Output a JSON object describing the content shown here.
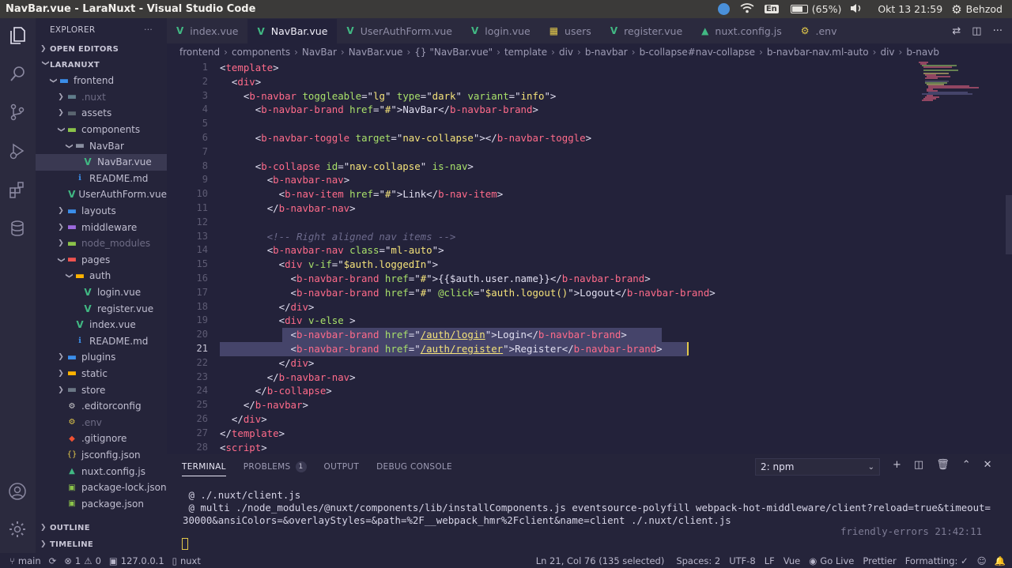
{
  "system": {
    "window_title": "NavBar.vue - LaraNuxt - Visual Studio Code",
    "keyboard": "En",
    "battery": "(65%)",
    "datetime": "Okt 13 21:59",
    "user": "Behzod"
  },
  "sidebar": {
    "title": "EXPLORER",
    "more": "···",
    "open_editors": "OPEN EDITORS",
    "project": "LARANUXT",
    "outline": "OUTLINE",
    "timeline": "TIMELINE",
    "tree": [
      {
        "label": "frontend",
        "depth": 1,
        "type": "folder-open",
        "color": "#3b8eea",
        "chev": "open"
      },
      {
        "label": ".nuxt",
        "depth": 2,
        "type": "folder",
        "color": "#607d8b",
        "chev": "closed",
        "dim": true
      },
      {
        "label": "assets",
        "depth": 2,
        "type": "folder",
        "color": "#5a6570",
        "chev": "closed"
      },
      {
        "label": "components",
        "depth": 2,
        "type": "folder",
        "color": "#8bc34a",
        "chev": "open"
      },
      {
        "label": "NavBar",
        "depth": 3,
        "type": "folder-open",
        "color": "#8a8fa0",
        "chev": "open"
      },
      {
        "label": "NavBar.vue",
        "depth": 4,
        "type": "vue",
        "color": "#41b883",
        "selected": true
      },
      {
        "label": "README.md",
        "depth": 3,
        "type": "info",
        "color": "#3b8eea"
      },
      {
        "label": "UserAuthForm.vue",
        "depth": 3,
        "type": "vue",
        "color": "#41b883"
      },
      {
        "label": "layouts",
        "depth": 2,
        "type": "folder",
        "color": "#3b8eea",
        "chev": "closed"
      },
      {
        "label": "middleware",
        "depth": 2,
        "type": "folder",
        "color": "#9c6ade",
        "chev": "closed"
      },
      {
        "label": "node_modules",
        "depth": 2,
        "type": "folder",
        "color": "#8bc34a",
        "chev": "closed",
        "dim": true
      },
      {
        "label": "pages",
        "depth": 2,
        "type": "folder-open",
        "color": "#ef5350",
        "chev": "open"
      },
      {
        "label": "auth",
        "depth": 3,
        "type": "folder-open",
        "color": "#ffb300",
        "chev": "open"
      },
      {
        "label": "login.vue",
        "depth": 4,
        "type": "vue",
        "color": "#41b883"
      },
      {
        "label": "register.vue",
        "depth": 4,
        "type": "vue",
        "color": "#41b883"
      },
      {
        "label": "index.vue",
        "depth": 3,
        "type": "vue",
        "color": "#41b883"
      },
      {
        "label": "README.md",
        "depth": 3,
        "type": "info",
        "color": "#3b8eea"
      },
      {
        "label": "plugins",
        "depth": 2,
        "type": "folder",
        "color": "#3b8eea",
        "chev": "closed"
      },
      {
        "label": "static",
        "depth": 2,
        "type": "folder",
        "color": "#ffb300",
        "chev": "closed"
      },
      {
        "label": "store",
        "depth": 2,
        "type": "folder",
        "color": "#6b7785",
        "chev": "closed"
      },
      {
        "label": ".editorconfig",
        "depth": 2,
        "type": "gear",
        "color": "#d0d0d0"
      },
      {
        "label": ".env",
        "depth": 2,
        "type": "env",
        "color": "#e2c84a",
        "dim": true
      },
      {
        "label": ".gitignore",
        "depth": 2,
        "type": "git",
        "color": "#f05133"
      },
      {
        "label": "jsconfig.json",
        "depth": 2,
        "type": "json",
        "color": "#e2c84a"
      },
      {
        "label": "nuxt.config.js",
        "depth": 2,
        "type": "nuxt",
        "color": "#41b883"
      },
      {
        "label": "package-lock.json",
        "depth": 2,
        "type": "npm",
        "color": "#8bc34a"
      },
      {
        "label": "package.json",
        "depth": 2,
        "type": "npm",
        "color": "#8bc34a"
      }
    ]
  },
  "tabs": [
    {
      "label": "index.vue",
      "icon": "vue",
      "active": false
    },
    {
      "label": "NavBar.vue",
      "icon": "vue",
      "active": true
    },
    {
      "label": "UserAuthForm.vue",
      "icon": "vue",
      "active": false
    },
    {
      "label": "login.vue",
      "icon": "vue",
      "active": false
    },
    {
      "label": "users",
      "icon": "table",
      "active": false
    },
    {
      "label": "register.vue",
      "icon": "vue",
      "active": false
    },
    {
      "label": "nuxt.config.js",
      "icon": "nuxt",
      "active": false
    },
    {
      "label": ".env",
      "icon": "env",
      "active": false
    }
  ],
  "breadcrumb": [
    "frontend",
    "components",
    "NavBar",
    "NavBar.vue",
    "{} \"NavBar.vue\"",
    "template",
    "div",
    "b-navbar",
    "b-collapse#nav-collapse",
    "b-navbar-nav.ml-auto",
    "div",
    "b-navb"
  ],
  "editor": {
    "lines": [
      "<template>",
      "  <div>",
      "    <b-navbar toggleable=\"lg\" type=\"dark\" variant=\"info\">",
      "      <b-navbar-brand href=\"#\">NavBar</b-navbar-brand>",
      "",
      "      <b-navbar-toggle target=\"nav-collapse\"></b-navbar-toggle>",
      "",
      "      <b-collapse id=\"nav-collapse\" is-nav>",
      "        <b-navbar-nav>",
      "          <b-nav-item href=\"#\">Link</b-nav-item>",
      "        </b-navbar-nav>",
      "",
      "        <!-- Right aligned nav items -->",
      "        <b-navbar-nav class=\"ml-auto\">",
      "          <div v-if=\"$auth.loggedIn\">",
      "            <b-navbar-brand href=\"#\">{{$auth.user.name}}</b-navbar-brand>",
      "            <b-navbar-brand href=\"#\" @click=\"$auth.logout()\">Logout</b-navbar-brand>",
      "          </div>",
      "          <div v-else >",
      "            <b-navbar-brand href=\"/auth/login\">Login</b-navbar-brand>",
      "            <b-navbar-brand href=\"/auth/register\">Register</b-navbar-brand>",
      "          </div>",
      "        </b-navbar-nav>",
      "      </b-collapse>",
      "    </b-navbar>",
      "  </div>",
      "</template>",
      "<script>"
    ]
  },
  "panel": {
    "tabs": [
      {
        "label": "TERMINAL",
        "active": true
      },
      {
        "label": "PROBLEMS",
        "badge": "1"
      },
      {
        "label": "OUTPUT"
      },
      {
        "label": "DEBUG CONSOLE"
      }
    ],
    "terminal_select": "2: npm",
    "terminal_lines": [
      " @ ./.nuxt/client.js",
      " @ multi ./node_modules/@nuxt/components/lib/installComponents.js eventsource-polyfill webpack-hot-middleware/client?reload=true&timeout=",
      "30000&ansiColors=&overlayStyles=&path=%2F__webpack_hmr%2Fclient&name=client ./.nuxt/client.js"
    ],
    "friendly": "friendly-errors 21:42:11"
  },
  "statusbar": {
    "branch": "main",
    "errors": "1",
    "warnings": "0",
    "host": "127.0.0.1",
    "task": "nuxt",
    "position": "Ln 21, Col 76 (135 selected)",
    "spaces": "Spaces: 2",
    "encoding": "UTF-8",
    "eol": "LF",
    "language": "Vue",
    "golive": "Go Live",
    "prettier": "Prettier",
    "formatting": "Formatting: ✓"
  }
}
